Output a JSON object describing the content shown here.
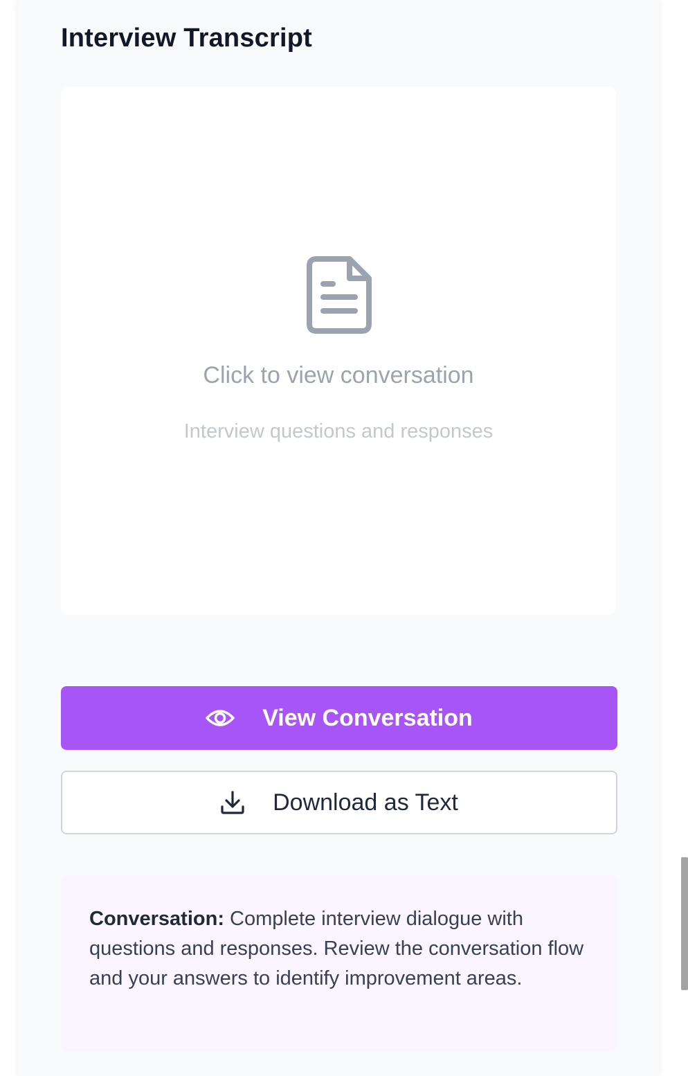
{
  "section": {
    "title": "Interview Transcript"
  },
  "preview": {
    "icon": "document-icon",
    "title": "Click to view conversation",
    "subtitle": "Interview questions and responses"
  },
  "actions": {
    "view": {
      "label": "View Conversation",
      "icon": "eye-icon"
    },
    "download": {
      "label": "Download as Text",
      "icon": "download-icon"
    }
  },
  "info": {
    "label": "Conversation:",
    "text": "Complete interview dialogue with questions and responses. Review the conversation flow and your answers to identify improvement areas."
  },
  "colors": {
    "accent": "#a855f7",
    "info_background": "#faf5ff",
    "icon_gray": "#9ca3af"
  }
}
